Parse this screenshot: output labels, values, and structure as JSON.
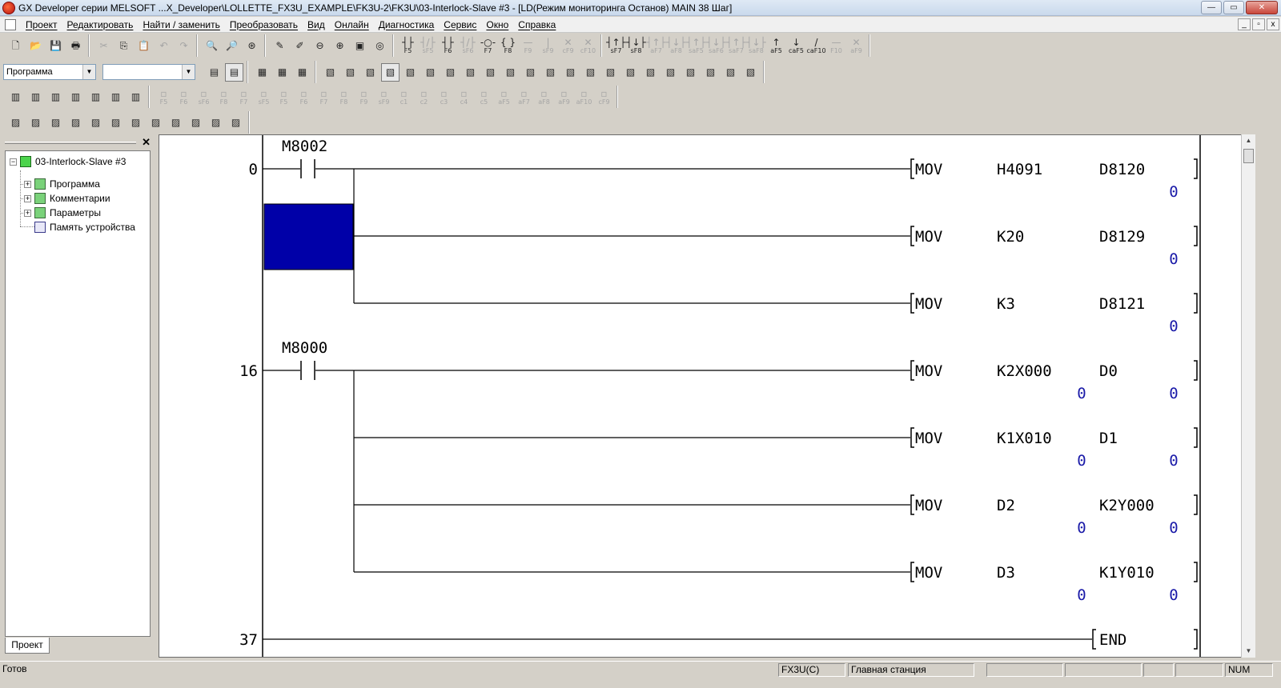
{
  "window": {
    "title": "GX Developer серии MELSOFT ...X_Developer\\LOLLETTE_FX3U_EXAMPLE\\FK3U-2\\FK3U\\03-Interlock-Slave #3 - [LD(Режим мониторинга Останов)    MAIN    38 Шаг]",
    "controls": {
      "minimize": "—",
      "maximize": "▭",
      "close": "✕"
    }
  },
  "menu": {
    "items": [
      "Проект",
      "Редактировать",
      "Найти / заменить",
      "Преобразовать",
      "Вид",
      "Онлайн",
      "Диагностика",
      "Сервис",
      "Окно",
      "Справка"
    ],
    "mdi_controls": {
      "minimize": "_",
      "restore": "▫",
      "close": "x"
    }
  },
  "toolbar": {
    "row1_file": [
      "new-file-icon",
      "open-file-icon",
      "save-icon",
      "print-icon"
    ],
    "row1_edit": [
      "cut-icon",
      "copy-icon",
      "paste-icon",
      "undo-icon",
      "redo-icon"
    ],
    "row1_search": [
      "find-device-icon",
      "find-instruction-icon",
      "find-step-icon"
    ],
    "row1_misc": [
      "write-plc-icon",
      "read-plc-icon",
      "zoom-out-icon",
      "zoom-in-icon",
      "monitor-start-icon",
      "monitor-stop-icon"
    ],
    "row1_ladder": [
      {
        "glyph": "┤├",
        "key": "F5",
        "dim": false
      },
      {
        "glyph": "┤/├",
        "key": "sF5",
        "dim": true
      },
      {
        "glyph": "┤├",
        "key": "F6",
        "dim": false
      },
      {
        "glyph": "┤/├",
        "key": "sF6",
        "dim": true
      },
      {
        "glyph": "-○-",
        "key": "F7",
        "dim": false
      },
      {
        "glyph": "{ }",
        "key": "F8",
        "dim": false
      },
      {
        "glyph": "—",
        "key": "F9",
        "dim": true
      },
      {
        "glyph": "|",
        "key": "sF9",
        "dim": true
      },
      {
        "glyph": "✕",
        "key": "cF9",
        "dim": true
      },
      {
        "glyph": "✕",
        "key": "cF10",
        "dim": true
      }
    ],
    "row1_ladder2": [
      {
        "glyph": "┤↑├",
        "key": "sF7",
        "dim": false
      },
      {
        "glyph": "┤↓├",
        "key": "sF8",
        "dim": false
      },
      {
        "glyph": "┤↑├",
        "key": "aF7",
        "dim": true
      },
      {
        "glyph": "┤↓├",
        "key": "aF8",
        "dim": true
      },
      {
        "glyph": "┤↑├",
        "key": "saF5",
        "dim": true
      },
      {
        "glyph": "┤↓├",
        "key": "saF6",
        "dim": true
      },
      {
        "glyph": "┤↑├",
        "key": "saF7",
        "dim": true
      },
      {
        "glyph": "┤↓├",
        "key": "saF8",
        "dim": true
      },
      {
        "glyph": "↑",
        "key": "aF5",
        "dim": false
      },
      {
        "glyph": "↓",
        "key": "caF5",
        "dim": false
      },
      {
        "glyph": "/",
        "key": "caF10",
        "dim": false
      },
      {
        "glyph": "—",
        "key": "F10",
        "dim": true
      },
      {
        "glyph": "✕",
        "key": "aF9",
        "dim": true
      }
    ],
    "program_combo": "Программа",
    "program_combo_2": "",
    "row3_keys": [
      "F5",
      "F6",
      "sF6",
      "F8",
      "F7",
      "sF5",
      "F5",
      "F6",
      "F7",
      "F8",
      "F9",
      "sF9",
      "c1",
      "c2",
      "c3",
      "c4",
      "c5",
      "aF5",
      "aF7",
      "aF8",
      "aF9",
      "aF10",
      "cF9"
    ]
  },
  "project_tree": {
    "root": "03-Interlock-Slave #3",
    "children": [
      "Программа",
      "Комментарии",
      "Параметры",
      "Память устройства"
    ],
    "tab": "Проект",
    "close_glyph": "✕"
  },
  "ladder": {
    "rungs": [
      {
        "step": "0",
        "contact": "M8002",
        "outputs": [
          {
            "instr": "MOV",
            "src": "H4091",
            "dst": "D8120",
            "src_val": "",
            "dst_val": "0"
          },
          {
            "instr": "MOV",
            "src": "K20",
            "dst": "D8129",
            "src_val": "",
            "dst_val": "0"
          },
          {
            "instr": "MOV",
            "src": "K3",
            "dst": "D8121",
            "src_val": "",
            "dst_val": "0"
          }
        ]
      },
      {
        "step": "16",
        "contact": "M8000",
        "outputs": [
          {
            "instr": "MOV",
            "src": "K2X000",
            "dst": "D0",
            "src_val": "0",
            "dst_val": "0"
          },
          {
            "instr": "MOV",
            "src": "K1X010",
            "dst": "D1",
            "src_val": "0",
            "dst_val": "0"
          },
          {
            "instr": "MOV",
            "src": "D2",
            "dst": "K2Y000",
            "src_val": "0",
            "dst_val": "0"
          },
          {
            "instr": "MOV",
            "src": "D3",
            "dst": "K1Y010",
            "src_val": "0",
            "dst_val": "0"
          }
        ]
      },
      {
        "step": "37",
        "end": "END"
      }
    ],
    "cursor_color": "#0000a8"
  },
  "status": {
    "ready": "Готов",
    "cpu": "FX3U(C)",
    "station": "Главная станция",
    "num": "NUM"
  }
}
